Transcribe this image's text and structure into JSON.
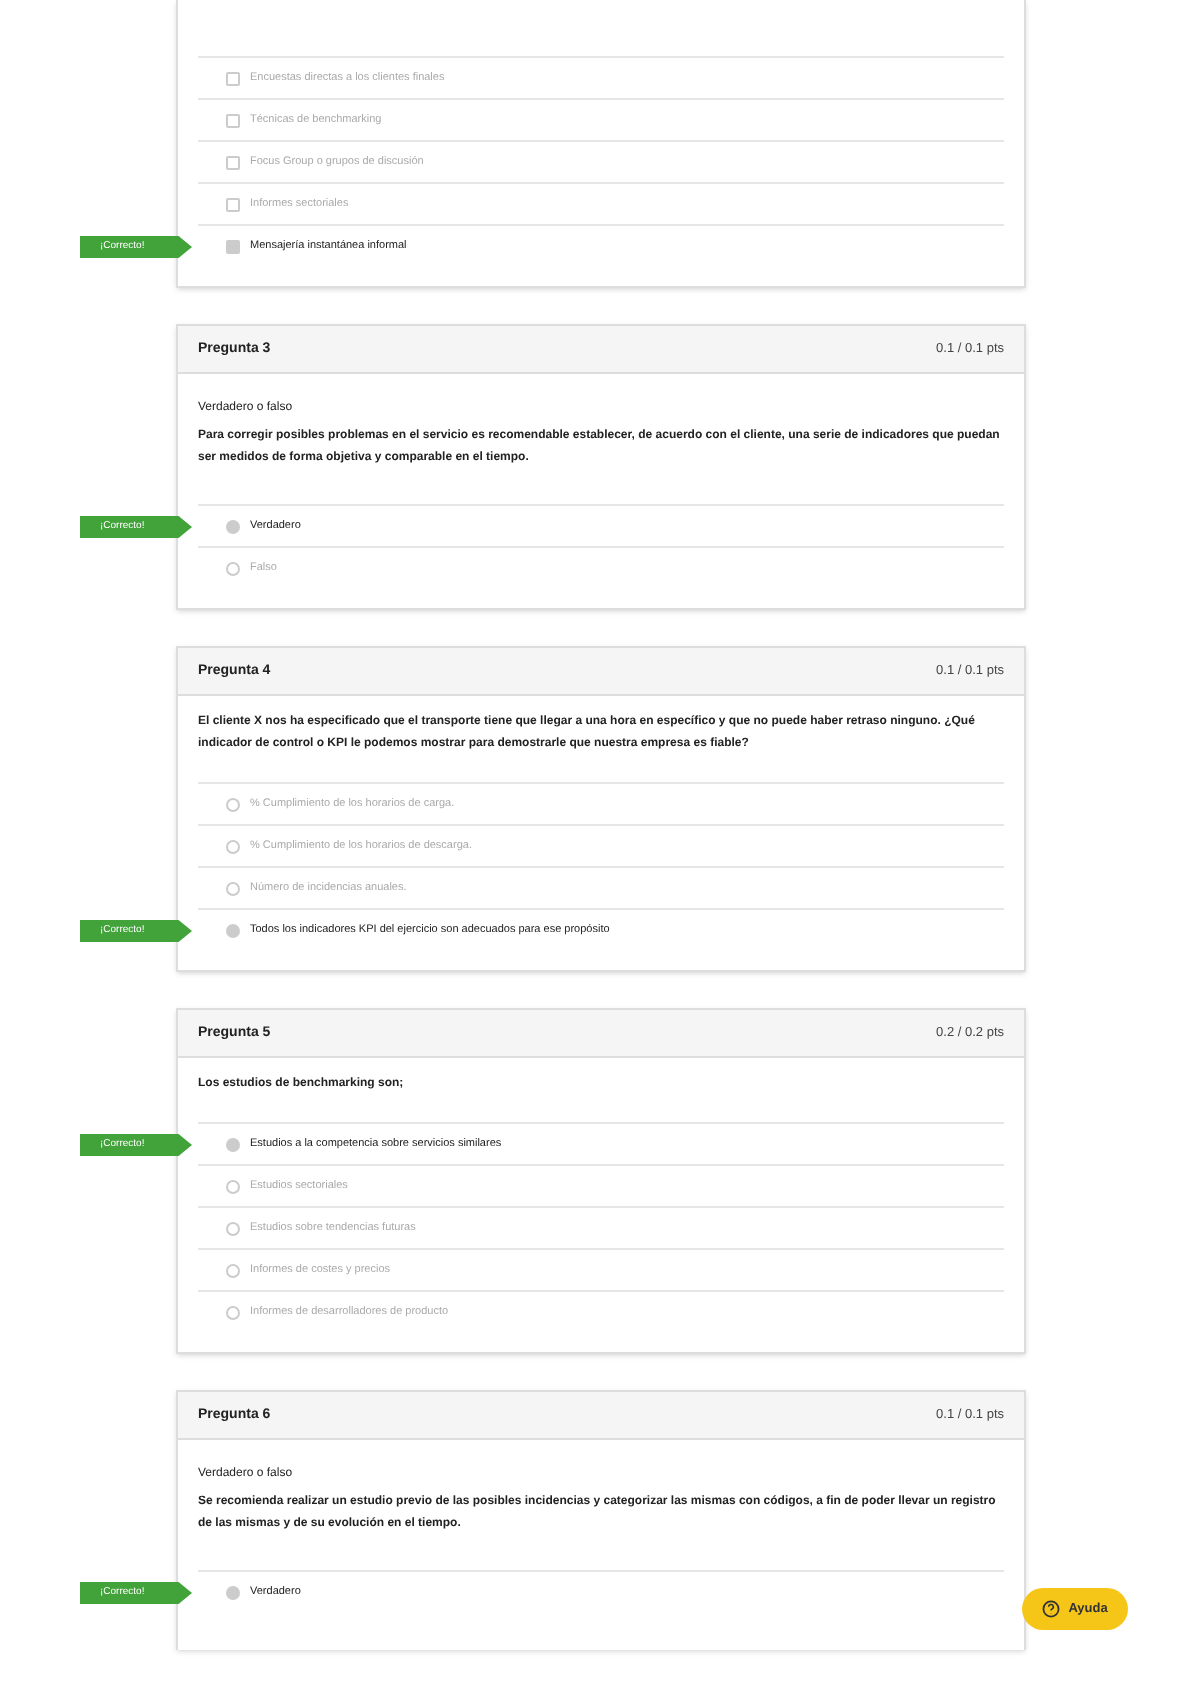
{
  "questions": [
    {
      "partial": true,
      "options": [
        {
          "kind": "checkbox",
          "text": "Encuestas directas a los clientes finales",
          "selected": false
        },
        {
          "kind": "checkbox",
          "text": "Técnicas de benchmarking",
          "selected": false
        },
        {
          "kind": "checkbox",
          "text": "Focus Group o grupos de discusión",
          "selected": false
        },
        {
          "kind": "checkbox",
          "text": "Informes sectoriales",
          "selected": false
        },
        {
          "kind": "checkbox",
          "text": "Mensajería instantánea informal",
          "selected": true,
          "flag": "¡Correcto!"
        }
      ]
    },
    {
      "title": "Pregunta 3",
      "score": "0.1 / 0.1 pts",
      "subtitle": "Verdadero o falso",
      "text": "Para corregir posibles problemas en el servicio es recomendable establecer, de acuerdo con el cliente, una serie de indicadores que puedan ser medidos de forma objetiva y comparable en el tiempo.",
      "options": [
        {
          "kind": "radio",
          "text": "Verdadero",
          "selected": true,
          "flag": "¡Correcto!"
        },
        {
          "kind": "radio",
          "text": "Falso",
          "selected": false
        }
      ]
    },
    {
      "title": "Pregunta 4",
      "score": "0.1 / 0.1 pts",
      "text": "El cliente X nos ha especificado que el transporte tiene que llegar a una hora en específico y que no puede haber retraso ninguno. ¿Qué indicador de control o KPI le podemos mostrar para demostrarle que nuestra empresa es fiable?",
      "options": [
        {
          "kind": "radio",
          "text": "% Cumplimiento de los horarios de carga.",
          "selected": false
        },
        {
          "kind": "radio",
          "text": "% Cumplimiento de los horarios de descarga.",
          "selected": false
        },
        {
          "kind": "radio",
          "text": "Número de incidencias anuales.",
          "selected": false
        },
        {
          "kind": "radio",
          "text": "Todos los indicadores KPI del ejercicio son adecuados para ese propósito",
          "selected": true,
          "flag": "¡Correcto!"
        }
      ]
    },
    {
      "title": "Pregunta 5",
      "score": "0.2 / 0.2 pts",
      "text": "Los estudios de benchmarking son;",
      "options": [
        {
          "kind": "radio",
          "text": "Estudios a la competencia sobre servicios similares",
          "selected": true,
          "flag": "¡Correcto!"
        },
        {
          "kind": "radio",
          "text": "Estudios sectoriales",
          "selected": false
        },
        {
          "kind": "radio",
          "text": "Estudios sobre tendencias futuras",
          "selected": false
        },
        {
          "kind": "radio",
          "text": "Informes de costes y precios",
          "selected": false
        },
        {
          "kind": "radio",
          "text": "Informes de desarrolladores de producto",
          "selected": false
        }
      ]
    },
    {
      "title": "Pregunta 6",
      "score": "0.1 / 0.1 pts",
      "subtitle": "Verdadero o falso",
      "text": "Se recomienda realizar un estudio previo de las posibles incidencias y categorizar las mismas con códigos, a fin de poder llevar un registro de las mismas y de su evolución en el tiempo.",
      "cut": true,
      "options": [
        {
          "kind": "radio",
          "text": "Verdadero",
          "selected": true,
          "flag": "¡Correcto!"
        }
      ]
    }
  ],
  "help": {
    "label": "Ayuda"
  }
}
